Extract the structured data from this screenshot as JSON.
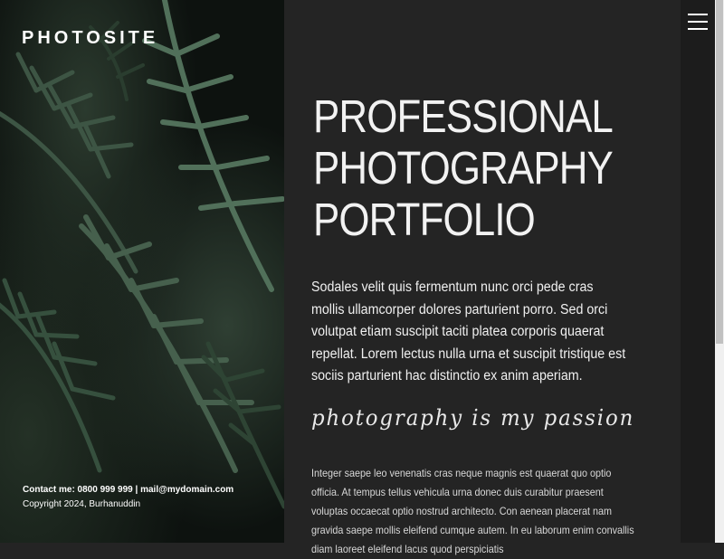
{
  "brand": {
    "name": "PHOTOSITE"
  },
  "hero": {
    "contact_line": "Contact me: 0800 999 999 | mail@mydomain.com",
    "copyright": "Copyright 2024, Burhanuddin"
  },
  "main": {
    "headline_1": "PROFESSIONAL",
    "headline_2": "PHOTOGRAPHY",
    "headline_3": "PORTFOLIO",
    "lead": "Sodales velit quis fermentum nunc orci pede cras mollis ullamcorper dolores parturient porro. Sed orci volutpat etiam suscipit taciti platea corporis quaerat repellat. Lorem lectus nulla urna et suscipit tristique est sociis parturient hac distinctio ex anim aperiam.",
    "tagline": "photography is my passion",
    "body": "Integer saepe leo venenatis cras neque magnis est quaerat quo optio officia. At tempus tellus vehicula urna donec duis curabitur praesent voluptas occaecat optio nostrud architecto. Con aenean placerat nam gravida saepe mollis eleifend cumque autem. In eu laborum enim convallis diam laoreet eleifend lacus quod perspiciatis"
  },
  "icons": {
    "menu": "hamburger-menu-icon"
  },
  "colors": {
    "background": "#242424",
    "sidebar": "#1c1c1c",
    "text": "#f0f0f0"
  }
}
